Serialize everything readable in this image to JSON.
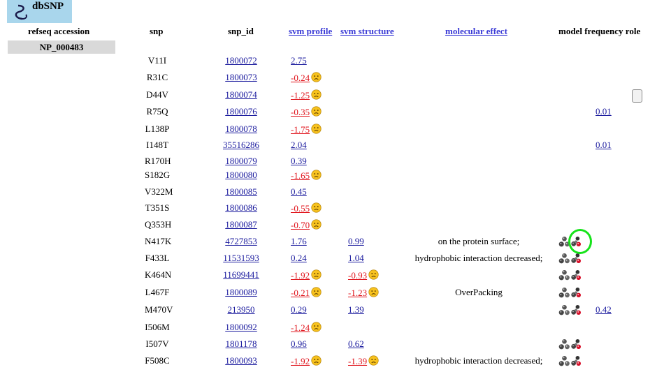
{
  "app": {
    "logo_text": "dbSNP"
  },
  "headers": {
    "refseq": "refseq accession",
    "snp": "snp",
    "snp_id": "snp_id",
    "svm_profile": "svm profile",
    "svm_structure": "svm structure",
    "molecular_effect": "molecular effect",
    "model_frequency_role": "model frequency role"
  },
  "accession": "NP_000483",
  "icons": {
    "frown": "sad-face-icon",
    "molecule_gray": "molecule-model-icon",
    "molecule_red": "molecule-model-red-icon"
  },
  "colors": {
    "negative": "#e0131b",
    "link": "#1b1b9e",
    "header_link": "#3b3bd6",
    "logo_bg": "#a9d6ec",
    "highlight": "#16e31a"
  },
  "rows": [
    {
      "snp": "V11I",
      "id": "1800072",
      "profile": "2.75",
      "profile_neg": false,
      "structure": "",
      "structure_neg": false,
      "effect": "",
      "model": false,
      "freq": ""
    },
    {
      "snp": "R31C",
      "id": "1800073",
      "profile": "-0.24",
      "profile_neg": true,
      "structure": "",
      "structure_neg": false,
      "effect": "",
      "model": false,
      "freq": ""
    },
    {
      "snp": "D44V",
      "id": "1800074",
      "profile": "-1.25",
      "profile_neg": true,
      "structure": "",
      "structure_neg": false,
      "effect": "",
      "model": false,
      "freq": ""
    },
    {
      "snp": "R75Q",
      "id": "1800076",
      "profile": "-0.35",
      "profile_neg": true,
      "structure": "",
      "structure_neg": false,
      "effect": "",
      "model": false,
      "freq": "0.01"
    },
    {
      "snp": "L138P",
      "id": "1800078",
      "profile": "-1.75",
      "profile_neg": true,
      "structure": "",
      "structure_neg": false,
      "effect": "",
      "model": false,
      "freq": ""
    },
    {
      "snp": "I148T",
      "id": "35516286",
      "profile": "2.04",
      "profile_neg": false,
      "structure": "",
      "structure_neg": false,
      "effect": "",
      "model": false,
      "freq": "0.01"
    },
    {
      "snp": "R170H",
      "id": "1800079",
      "profile": "0.39",
      "profile_neg": false,
      "structure": "",
      "structure_neg": false,
      "effect": "",
      "model": false,
      "freq": ""
    },
    {
      "snp": "S182G",
      "id": "1800080",
      "profile": "-1.65",
      "profile_neg": true,
      "structure": "",
      "structure_neg": false,
      "effect": "",
      "model": false,
      "freq": ""
    },
    {
      "snp": "V322M",
      "id": "1800085",
      "profile": "0.45",
      "profile_neg": false,
      "structure": "",
      "structure_neg": false,
      "effect": "",
      "model": false,
      "freq": ""
    },
    {
      "snp": "T351S",
      "id": "1800086",
      "profile": "-0.55",
      "profile_neg": true,
      "structure": "",
      "structure_neg": false,
      "effect": "",
      "model": false,
      "freq": ""
    },
    {
      "snp": "Q353H",
      "id": "1800087",
      "profile": "-0.70",
      "profile_neg": true,
      "structure": "",
      "structure_neg": false,
      "effect": "",
      "model": false,
      "freq": ""
    },
    {
      "snp": "N417K",
      "id": "4727853",
      "profile": "1.76",
      "profile_neg": false,
      "structure": "0.99",
      "structure_neg": false,
      "effect": "on the protein surface;",
      "model": true,
      "freq": ""
    },
    {
      "snp": "F433L",
      "id": "11531593",
      "profile": "0.24",
      "profile_neg": false,
      "structure": "1.04",
      "structure_neg": false,
      "effect": "hydrophobic interaction decreased;",
      "model": true,
      "freq": ""
    },
    {
      "snp": "K464N",
      "id": "11699441",
      "profile": "-1.92",
      "profile_neg": true,
      "structure": "-0.93",
      "structure_neg": true,
      "effect": "",
      "model": true,
      "freq": ""
    },
    {
      "snp": "L467F",
      "id": "1800089",
      "profile": "-0.21",
      "profile_neg": true,
      "structure": "-1.23",
      "structure_neg": true,
      "effect": "OverPacking",
      "model": true,
      "freq": ""
    },
    {
      "snp": "M470V",
      "id": "213950",
      "profile": "0.29",
      "profile_neg": false,
      "structure": "1.39",
      "structure_neg": false,
      "effect": "",
      "model": true,
      "freq": "0.42"
    },
    {
      "snp": "I506M",
      "id": "1800092",
      "profile": "-1.24",
      "profile_neg": true,
      "structure": "",
      "structure_neg": false,
      "effect": "",
      "model": false,
      "freq": ""
    },
    {
      "snp": "I507V",
      "id": "1801178",
      "profile": "0.96",
      "profile_neg": false,
      "structure": "0.62",
      "structure_neg": false,
      "effect": "",
      "model": true,
      "freq": ""
    },
    {
      "snp": "F508C",
      "id": "1800093",
      "profile": "-1.92",
      "profile_neg": true,
      "structure": "-1.39",
      "structure_neg": true,
      "effect": "hydrophobic interaction decreased;",
      "model": true,
      "freq": ""
    }
  ]
}
